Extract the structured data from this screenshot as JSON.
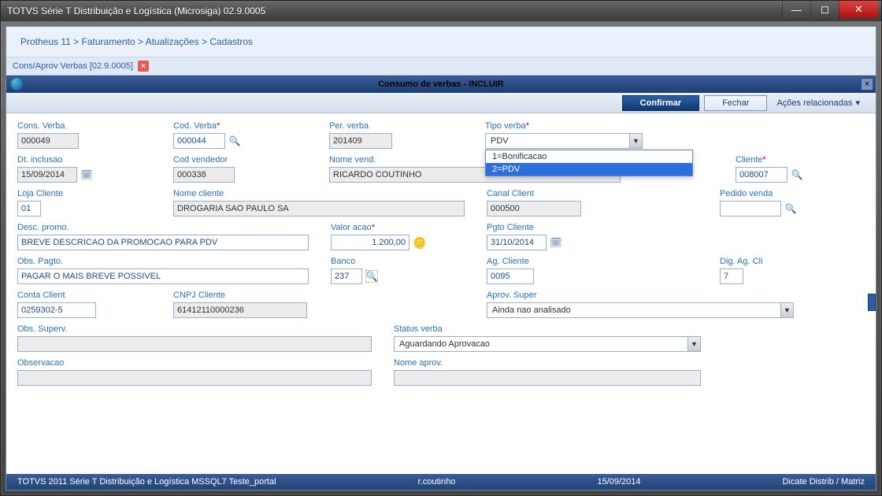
{
  "window": {
    "title": "TOTVS Série T Distribuição e Logística (Microsiga) 02.9.0005"
  },
  "breadcrumb": {
    "p1": "Protheus 11",
    "p2": "Faturamento",
    "p3": "Atualizações",
    "p4": "Cadastros"
  },
  "tab": {
    "label": "Cons/Aprov Verbas [02.9.0005]"
  },
  "subwin": {
    "title": "Consumo de verbas - INCLUIR"
  },
  "actions": {
    "confirm": "Confirmar",
    "close": "Fechar",
    "related": "Ações relacionadas"
  },
  "labels": {
    "cons_verba": "Cons. Verba",
    "cod_verba": "Cod. Verba",
    "per_verba": "Per. verba",
    "tipo_verba": "Tipo verba",
    "dt_inclusao": "Dt. inclusao",
    "cod_vendedor": "Cod vendedor",
    "nome_vend": "Nome vend.",
    "cliente": "Cliente",
    "loja_cliente": "Loja Cliente",
    "nome_cliente": "Nome cliente",
    "canal_client": "Canal Client",
    "pedido_venda": "Pedido venda",
    "desc_promo": "Desc. promo.",
    "valor_acao": "Valor acao",
    "pgto_cliente": "Pgto Cliente",
    "obs_pagto": "Obs. Pagto.",
    "banco": "Banco",
    "ag_cliente": "Ag. Cliente",
    "dig_ag_cli": "Dig. Ag. Cli",
    "conta_client": "Conta Client",
    "cnpj_cliente": "CNPJ Cliente",
    "aprov_super": "Aprov. Super",
    "obs_superv": "Obs. Superv.",
    "status_verba": "Status verba",
    "observacao": "Observacao",
    "nome_aprov": "Nome aprov."
  },
  "values": {
    "cons_verba": "000049",
    "cod_verba": "000044",
    "per_verba": "201409",
    "tipo_verba_selected": "PDV",
    "dt_inclusao": "15/09/2014",
    "cod_vendedor": "000338",
    "nome_vend": "RICARDO COUTINHO",
    "cliente": "008007",
    "loja_cliente": "01",
    "nome_cliente": "DROGARIA SAO PAULO SA",
    "canal_client": "000500",
    "pedido_venda": "",
    "desc_promo": "BREVE DESCRICAO DA PROMOCAO PARA PDV",
    "valor_acao": "1.200,00",
    "pgto_cliente": "31/10/2014",
    "obs_pagto": "PAGAR O MAIS BREVE POSSIVEL",
    "banco": "237",
    "ag_cliente": "0095",
    "dig_ag_cli": "7",
    "conta_client": "0259302-5",
    "cnpj_cliente": "61412110000236",
    "aprov_super": "Ainda nao analisado",
    "obs_superv": "",
    "status_verba": "Aguardando Aprovacao",
    "observacao": "",
    "nome_aprov": ""
  },
  "tipo_verba_options": {
    "opt1": "1=Bonificacao",
    "opt2": "2=PDV"
  },
  "statusbar": {
    "left": "TOTVS 2011 Série T Distribuição e Logística MSSQL7 Teste_portal",
    "user": "r.coutinho",
    "date": "15/09/2014",
    "right": "Dicate Distrib / Matriz"
  }
}
